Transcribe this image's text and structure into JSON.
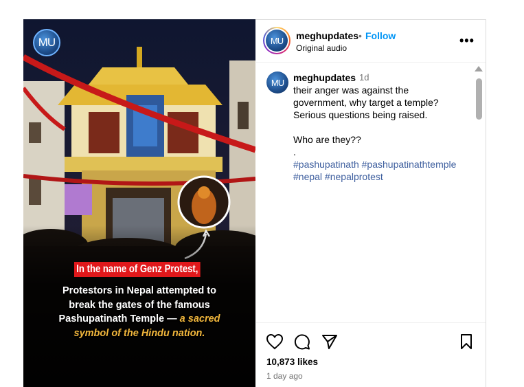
{
  "media": {
    "badge_text": "MU",
    "caption_highlight": "In the name of Genz Protest,",
    "caption_line1": "Protestors in Nepal attempted to",
    "caption_line2": "break the gates of the famous",
    "caption_line3_plain": "Pashupatinath Temple — ",
    "caption_line3_italic": "a sacred",
    "caption_line4_italic": "symbol of the Hindu nation."
  },
  "header": {
    "avatar_text": "MU",
    "username": "meghupdates",
    "separator": "•",
    "follow_label": "Follow",
    "audio_label": "Original audio",
    "more_label": "•••"
  },
  "comment": {
    "avatar_text": "MU",
    "username": "meghupdates",
    "time": "1d",
    "line1": "their anger was against the",
    "line2": "government, why target a temple?",
    "line3": "Serious questions being raised.",
    "line4": "Who are they??",
    "line5": ".",
    "tags_line1": "#pashupatinath #pashupatinathtemple",
    "tags_line2": "#nepal #nepalprotest"
  },
  "actions": {
    "likes": "10,873 likes",
    "time_ago": "1 day ago",
    "icons": [
      "heart-icon",
      "comment-icon",
      "share-icon",
      "bookmark-icon"
    ]
  },
  "colors": {
    "follow": "#0095f6",
    "hashtag": "#3d5e9e",
    "caption_red": "#e0181b",
    "caption_gold": "#f2b73c"
  }
}
